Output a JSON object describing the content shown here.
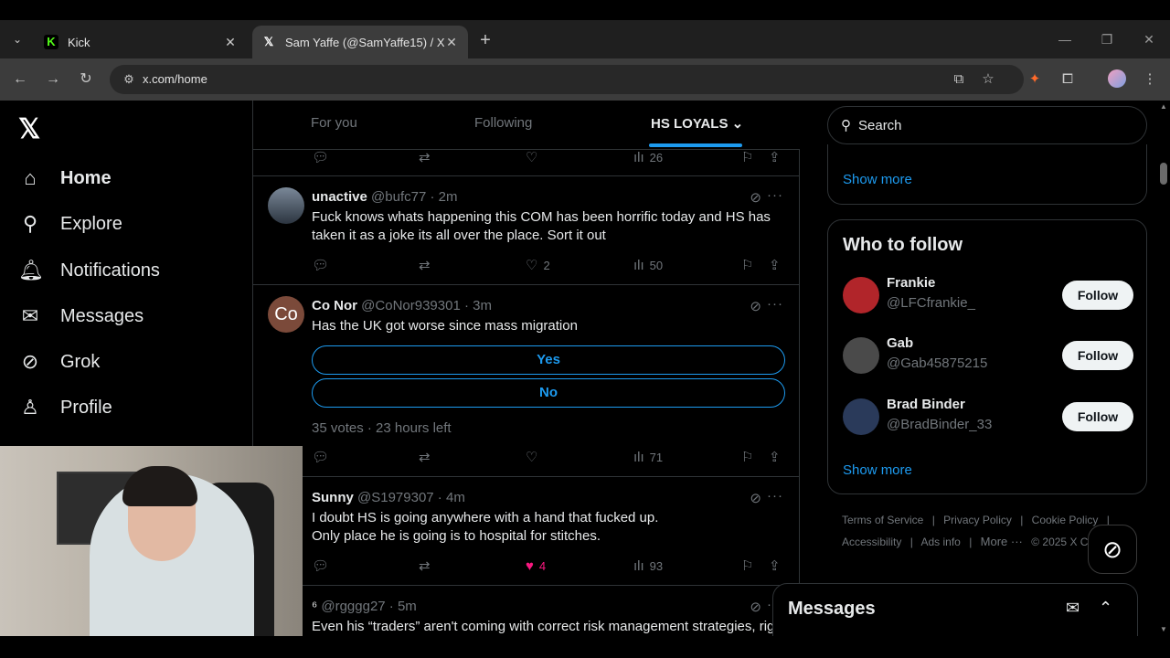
{
  "browser": {
    "tabs": [
      {
        "title": "Kick",
        "favicon": "K"
      },
      {
        "title": "Sam Yaffe (@SamYaffe15) / X",
        "favicon": "𝕏"
      }
    ],
    "url": "x.com/home"
  },
  "left_nav": {
    "logo": "𝕏",
    "items": [
      {
        "label": "Home",
        "icon": "home-icon"
      },
      {
        "label": "Explore",
        "icon": "search-icon"
      },
      {
        "label": "Notifications",
        "icon": "bell-icon"
      },
      {
        "label": "Messages",
        "icon": "envelope-icon"
      },
      {
        "label": "Grok",
        "icon": "grok-icon"
      },
      {
        "label": "Profile",
        "icon": "person-icon"
      }
    ]
  },
  "timeline": {
    "tabs": [
      "For you",
      "Following",
      "HS LOYALS"
    ],
    "top_partial": {
      "views": "26"
    },
    "tweets": [
      {
        "name": "unactive",
        "handle": "@bufc77 · 2m",
        "text": "Fuck knows whats happening this COM has been horrific today and HS  has taken it as a joke its all over the place. Sort it out",
        "likes": "2",
        "views": "50"
      },
      {
        "name": "Co Nor",
        "handle": "@CoNor939301 · 3m",
        "avatar_text": "Co",
        "text": "Has the UK got worse since mass migration",
        "poll": [
          "Yes",
          "No"
        ],
        "poll_meta": "35 votes · 23 hours left",
        "likes": "",
        "views": "71"
      },
      {
        "name": "Sunny",
        "handle": "@S1979307 · 4m",
        "text_lines": [
          "I doubt HS is going anywhere with a hand that fucked up.",
          "Only place he is going is to hospital for stitches."
        ],
        "likes": "4",
        "views": "93"
      },
      {
        "name": "⁶",
        "handle": "@rgggg27 · 5m",
        "text": "Even his “traders” aren't coming with correct risk management strategies, rigl"
      }
    ]
  },
  "right": {
    "search_placeholder": "Search",
    "show_more_1": "Show more",
    "who_to_follow": "Who to follow",
    "follow_label": "Follow",
    "suggestions": [
      {
        "name": "Frankie",
        "handle": "@LFCfrankie_"
      },
      {
        "name": "Gab",
        "handle": "@Gab45875215"
      },
      {
        "name": "Brad Binder",
        "handle": "@BradBinder_33"
      }
    ],
    "show_more_2": "Show more",
    "footer_row1": [
      "Terms of Service",
      "|",
      "Privacy Policy",
      "|",
      "Cookie Policy",
      "|"
    ],
    "footer_row2": [
      "Accessibility",
      "|",
      "Ads info",
      "|",
      "More ···",
      "© 2025 X C"
    ]
  },
  "messages_drawer": {
    "title": "Messages"
  }
}
